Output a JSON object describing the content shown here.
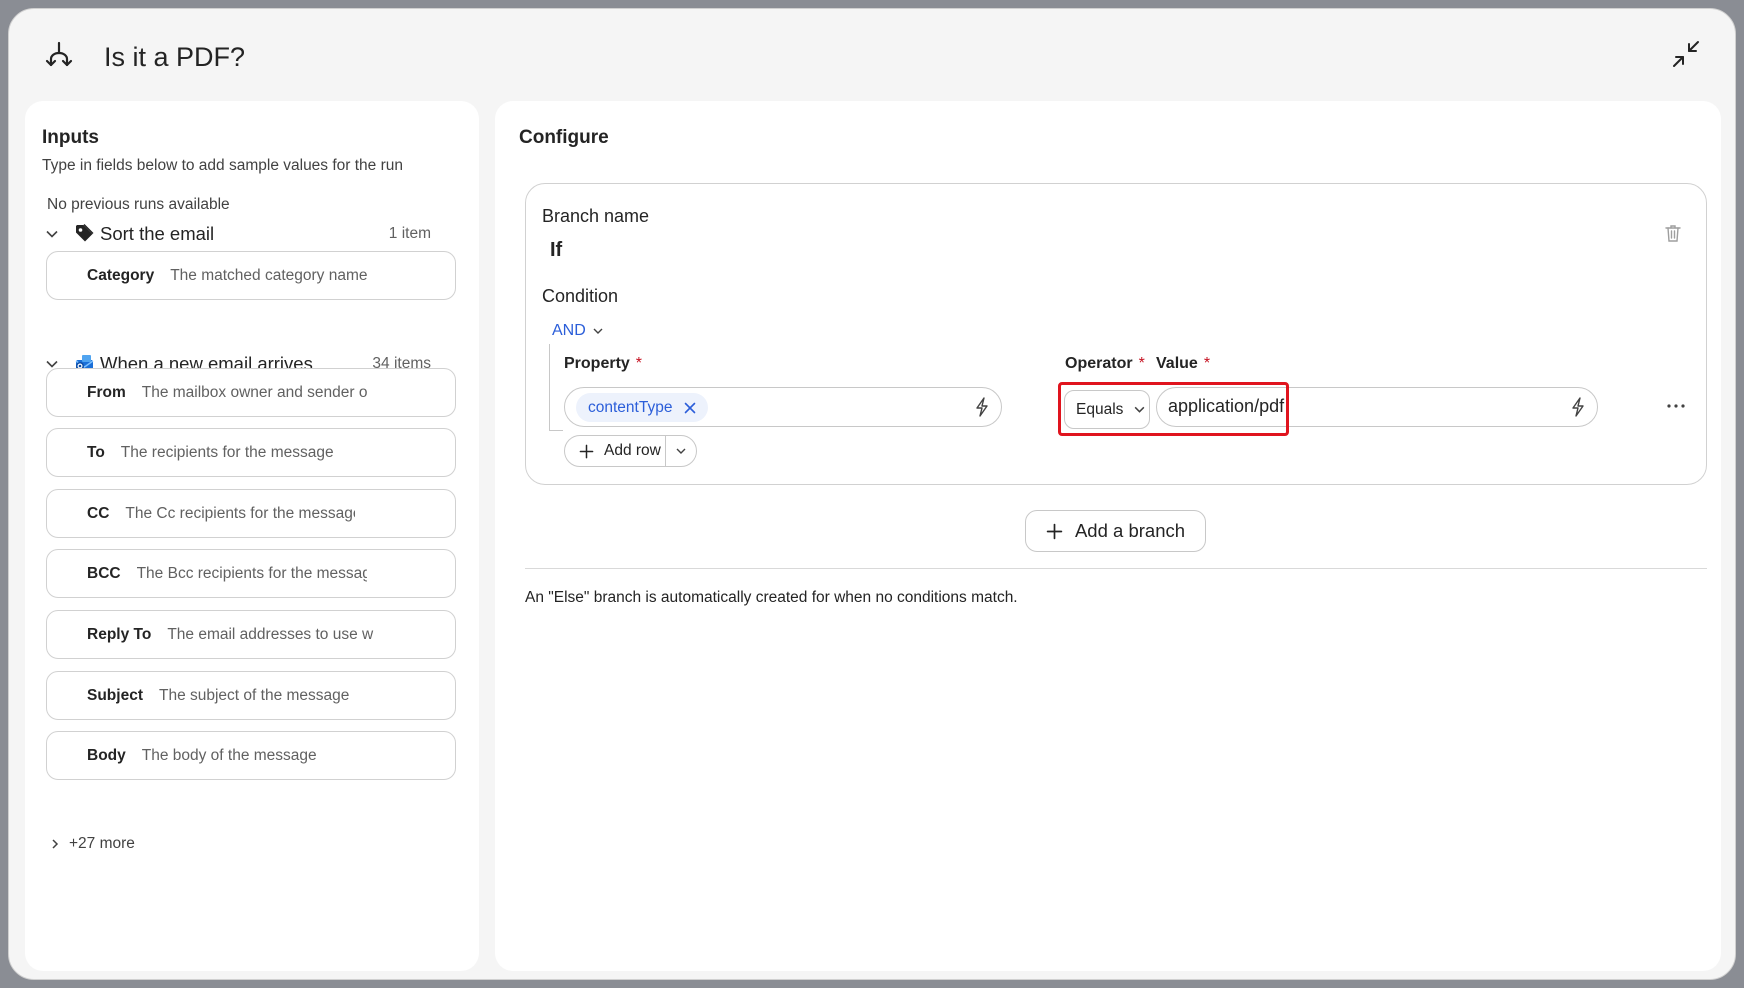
{
  "header": {
    "title": "Is it a PDF?",
    "icons": {
      "step": "branch-icon",
      "minimize": "collapse-arrows-icon"
    }
  },
  "inputs": {
    "title": "Inputs",
    "subtitle": "Type in fields below to add sample values for the run",
    "no_runs": "No previous runs available",
    "groups": [
      {
        "name": "Sort the email",
        "count": "1 item",
        "icon": "tag-icon",
        "fields": [
          {
            "label": "Category",
            "placeholder": "The matched category name"
          }
        ]
      },
      {
        "name": "When a new email arrives",
        "count": "34 items",
        "icon": "outlook-mail-icon",
        "fields": [
          {
            "label": "From",
            "placeholder": "The mailbox owner and sender o"
          },
          {
            "label": "To",
            "placeholder": "The recipients for the message"
          },
          {
            "label": "CC",
            "placeholder": "The Cc recipients for the message"
          },
          {
            "label": "BCC",
            "placeholder": "The Bcc recipients for the messag"
          },
          {
            "label": "Reply To",
            "placeholder": "The email addresses to use w"
          },
          {
            "label": "Subject",
            "placeholder": "The subject of the message"
          },
          {
            "label": "Body",
            "placeholder": "The body of the message"
          }
        ]
      }
    ],
    "more": "+27 more"
  },
  "configure": {
    "title": "Configure",
    "branch": {
      "name_label": "Branch name",
      "name_value": "If",
      "condition_label": "Condition",
      "logic": "AND",
      "property_label": "Property",
      "operator_label": "Operator",
      "value_label": "Value",
      "required_mark": "*",
      "property_token": "contentType",
      "operator": "Equals",
      "value": "application/pdf",
      "add_row": "Add row"
    },
    "add_branch": "Add a branch",
    "else_note": "An \"Else\" branch is automatically created for when no conditions match."
  },
  "colors": {
    "accent": "#2b5ed9",
    "highlight": "#e0141e",
    "required": "#c50f1f",
    "token_bg": "#edf2fc"
  }
}
